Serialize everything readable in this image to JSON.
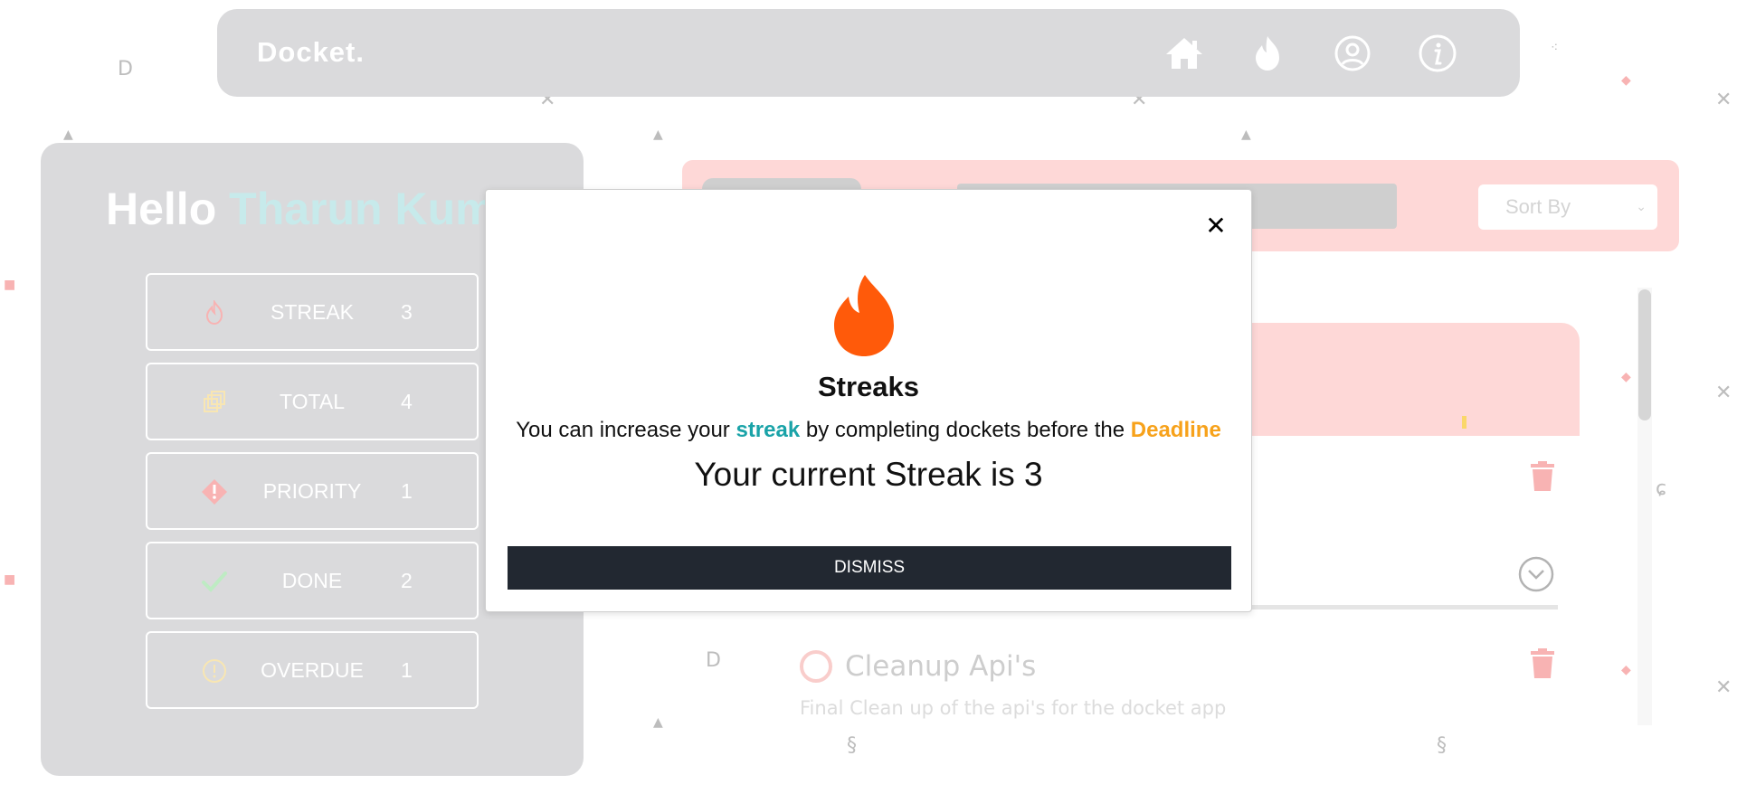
{
  "navbar": {
    "brand": "Docket.",
    "icons": [
      "home-icon",
      "flame-icon",
      "user-circle-icon",
      "info-icon"
    ]
  },
  "stats_panel": {
    "greeting": "Hello",
    "user_name": "Tharun Kuma",
    "stats": [
      {
        "label": "STREAK",
        "count": "3",
        "icon": "flame-icon",
        "color": "#f48a8a"
      },
      {
        "label": "TOTAL",
        "count": "4",
        "icon": "stack-icon",
        "color": "#f5d98a"
      },
      {
        "label": "PRIORITY",
        "count": "1",
        "icon": "alert-diamond-icon",
        "color": "#f48a8a"
      },
      {
        "label": "DONE",
        "count": "2",
        "icon": "check-icon",
        "color": "#9be0a3"
      },
      {
        "label": "OVERDUE",
        "count": "1",
        "icon": "clock-alert-icon",
        "color": "#f5d98a"
      }
    ]
  },
  "toolbar": {
    "sort_label": "Sort By"
  },
  "docket": {
    "task_title": "Cleanup Api's",
    "task_description": "Final Clean up of the api's for the docket app"
  },
  "modal": {
    "title": "Streaks",
    "text_prefix": "You can increase your",
    "text_streak": "streak",
    "text_middle": "by completing dockets before the",
    "text_deadline": "Deadline",
    "current_streak": "Your current Streak is 3",
    "dismiss_label": "DISMISS",
    "close_symbol": "✕"
  },
  "colors": {
    "accent_teal": "#1aa3a8",
    "accent_orange": "#f7a21b",
    "flame": "#ff5a0a",
    "dismiss_bg": "#222831",
    "panel_gray": "#c6c7c9",
    "pink": "#fdc4c2"
  }
}
